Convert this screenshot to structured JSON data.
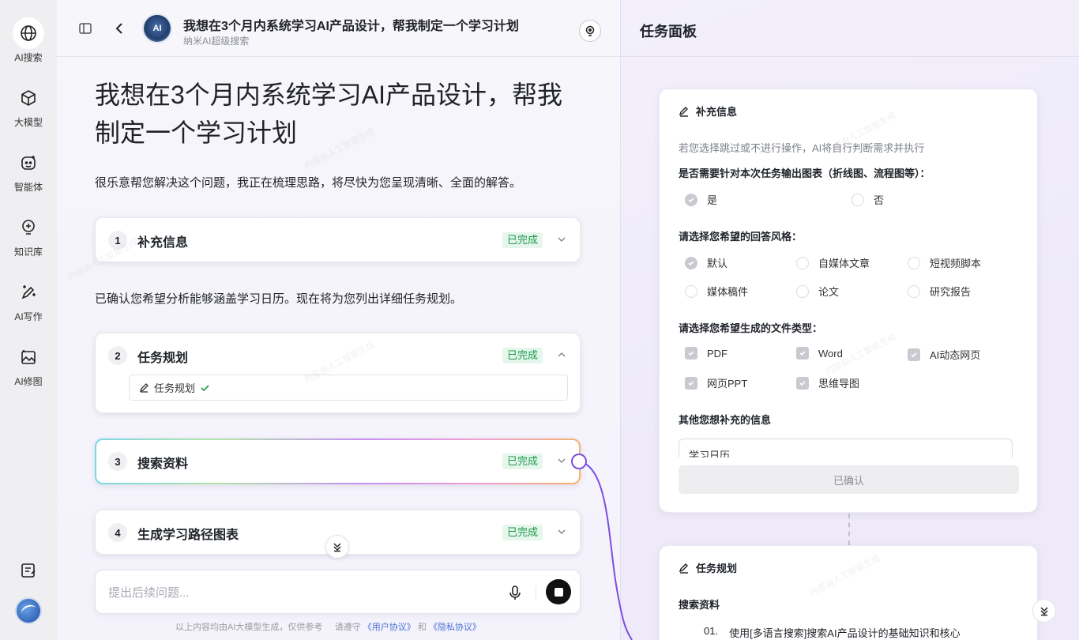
{
  "rail": {
    "items": [
      {
        "label": "AI搜索",
        "icon": "globe-icon"
      },
      {
        "label": "大模型",
        "icon": "cube-icon"
      },
      {
        "label": "智能体",
        "icon": "bot-icon"
      },
      {
        "label": "知识库",
        "icon": "bulb-icon"
      },
      {
        "label": "AI写作",
        "icon": "pen-sparkle-icon"
      },
      {
        "label": "AI修图",
        "icon": "image-edit-icon"
      }
    ]
  },
  "topbar": {
    "avatar_text": "AI",
    "title": "我想在3个月内系统学习AI产品设计，帮我制定一个学习计划",
    "subtitle": "纳米AI超级搜索"
  },
  "main": {
    "question": "我想在3个月内系统学习AI产品设计，帮我制定一个学习计划",
    "intro": "很乐意帮您解决这个问题，我正在梳理思路，将尽快为您呈现清晰、全面的解答。",
    "confirm_text": "已确认您希望分析能够涵盖学习日历。现在将为您列出详细任务规划。",
    "steps": [
      {
        "num": "1",
        "title": "补充信息",
        "status": "已完成"
      },
      {
        "num": "2",
        "title": "任务规划",
        "status": "已完成",
        "sub": "任务规划"
      },
      {
        "num": "3",
        "title": "搜索资料",
        "status": "已完成"
      },
      {
        "num": "4",
        "title": "生成学习路径图表",
        "status": "已完成"
      }
    ],
    "input_placeholder": "提出后续问题...",
    "footer_prefix": "以上内容均由AI大模型生成，仅供参考",
    "footer_mid": "请遵守",
    "footer_link1": "《用户协议》",
    "footer_and": "和",
    "footer_link2": "《隐私协议》"
  },
  "panel": {
    "title": "任务面板",
    "supplement": {
      "title": "补充信息",
      "hint": "若您选择跳过或不进行操作，AI将自行判断需求并执行",
      "q1": "是否需要针对本次任务输出图表（折线图、流程图等）：",
      "q1_options": [
        "是",
        "否"
      ],
      "q2": "请选择您希望的回答风格：",
      "q2_options": [
        "默认",
        "自媒体文章",
        "短视频脚本",
        "媒体稿件",
        "论文",
        "研究报告"
      ],
      "q3": "请选择您希望生成的文件类型：",
      "q3_options": [
        "PDF",
        "Word",
        "AI动态网页",
        "网页PPT",
        "思维导图"
      ],
      "q4": "其他您想补充的信息",
      "q4_value": "学习日历",
      "confirm_label": "已确认"
    },
    "plan": {
      "title": "任务规划",
      "section": "搜索资料",
      "item_num": "01.",
      "item_text": "使用[多语言搜索]搜索AI产品设计的基础知识和核心"
    }
  },
  "watermark": "内容由人工智能生成",
  "colors": {
    "done_green": "#1a9b4b",
    "connector_purple": "#7b4fe0",
    "link_blue": "#4a6fd8"
  }
}
